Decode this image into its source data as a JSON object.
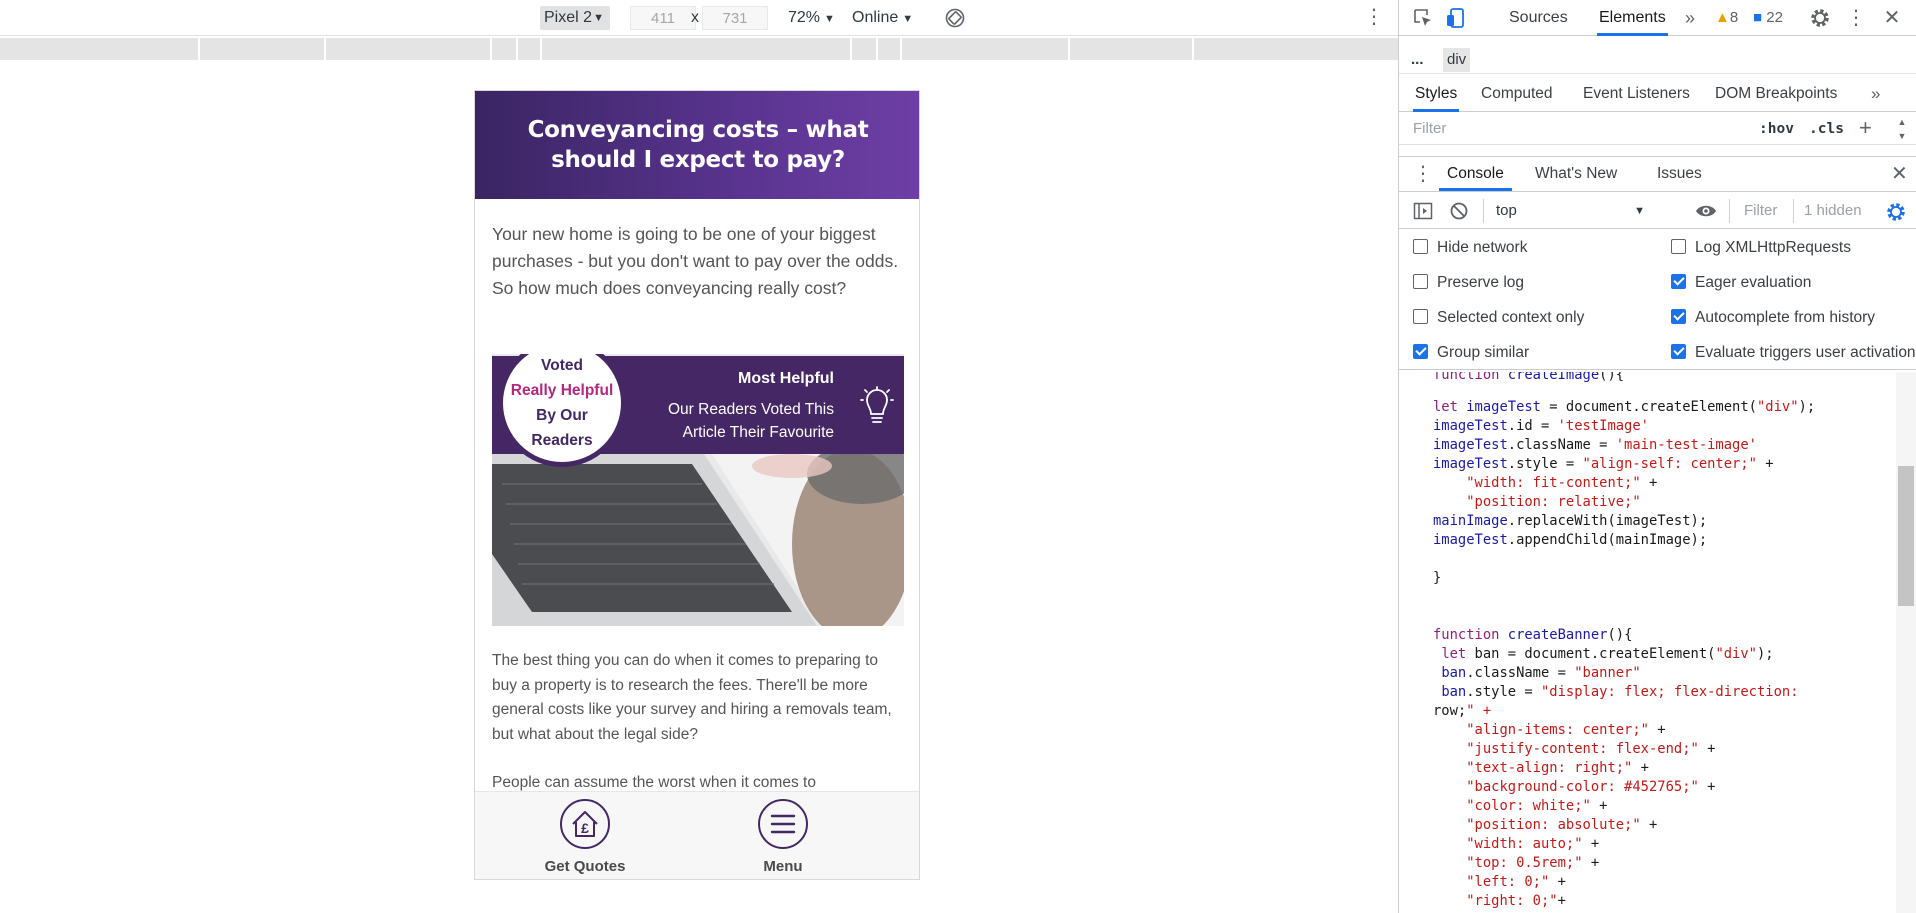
{
  "emulation_toolbar": {
    "device": "Pixel 2",
    "width": "411",
    "height": "731",
    "separator": "x",
    "zoom": "72%",
    "throttle": "Online"
  },
  "page": {
    "title": "Conveyancing costs – what should I expect to pay?",
    "intro": "Your new home is going to be one of your biggest purchases - but you don't want to pay over the odds. So how much does conveyancing really cost?",
    "vote_badge": {
      "line1": "Voted",
      "line2": "Really Helpful",
      "line3": "By Our",
      "line4": "Readers"
    },
    "banner": {
      "title": "Most Helpful",
      "subtitle": "Our Readers Voted This Article Their Favourite"
    },
    "body_paragraph": "The best thing you can do when it comes to preparing to buy a property is to research the fees. There'll be more general costs like your survey and hiring a removals team, but what about the legal side?",
    "body_paragraph_2": "People can assume the worst when it comes to",
    "nav": {
      "quotes_label": "Get Quotes",
      "menu_label": "Menu"
    }
  },
  "devtools": {
    "tabs": {
      "sources": "Sources",
      "elements": "Elements",
      "more": "»"
    },
    "warnings": "8",
    "messages": "22",
    "breadcrumb": {
      "dots": "...",
      "node": "div"
    },
    "styles_tabs": {
      "styles": "Styles",
      "computed": "Computed",
      "listeners": "Event Listeners",
      "dom": "DOM Breakpoints",
      "more": "»"
    },
    "styles_filter": "Filter",
    "hov": ":hov",
    "cls": ".cls",
    "drawer_tabs": {
      "console": "Console",
      "whats_new": "What's New",
      "issues": "Issues"
    },
    "console": {
      "context": "top",
      "filter_placeholder": "Filter",
      "hidden": "1 hidden"
    },
    "settings": {
      "hide_network": "Hide network",
      "preserve_log": "Preserve log",
      "selected_context": "Selected context only",
      "group_similar": "Group similar",
      "log_xhr": "Log XMLHttpRequests",
      "eager_eval": "Eager evaluation",
      "autocomplete": "Autocomplete from history",
      "evaluate_triggers": "Evaluate triggers user activation"
    },
    "code_lines": [
      "function createImage(){",
      "let imageTest = document.createElement(\"div\");",
      "imageTest.id = 'testImage'",
      "imageTest.className = 'main-test-image'",
      "imageTest.style = \"align-self: center;\" +",
      "    \"width: fit-content;\" +",
      "    \"position: relative;\"",
      "mainImage.replaceWith(imageTest);",
      "imageTest.appendChild(mainImage);",
      "}",
      "function createBanner(){",
      " let ban = document.createElement(\"div\");",
      " ban.className = \"banner\"",
      " ban.style = \"display: flex; flex-direction:",
      "row;\" +",
      "    \"align-items: center;\" +",
      "    \"justify-content: flex-end;\" +",
      "    \"text-align: right;\" +",
      "    \"background-color: #452765;\" +",
      "    \"color: white;\" +",
      "    \"position: absolute;\" +",
      "    \"width: auto;\" +",
      "    \"top: 0.5rem;\" +",
      "    \"left: 0;\" +",
      "    \"right: 0;\"+"
    ]
  },
  "colors": {
    "brand_purple": "#452765",
    "accent_magenta": "#b3287e",
    "devtools_blue": "#1a73e8"
  },
  "icons": {
    "rotate": "rotate-icon",
    "bulb": "lightbulb-icon",
    "quotes": "house-pound-icon",
    "menu": "hamburger-icon",
    "inspect": "inspect-icon",
    "device": "device-toggle-icon",
    "settings": "gear-icon"
  }
}
